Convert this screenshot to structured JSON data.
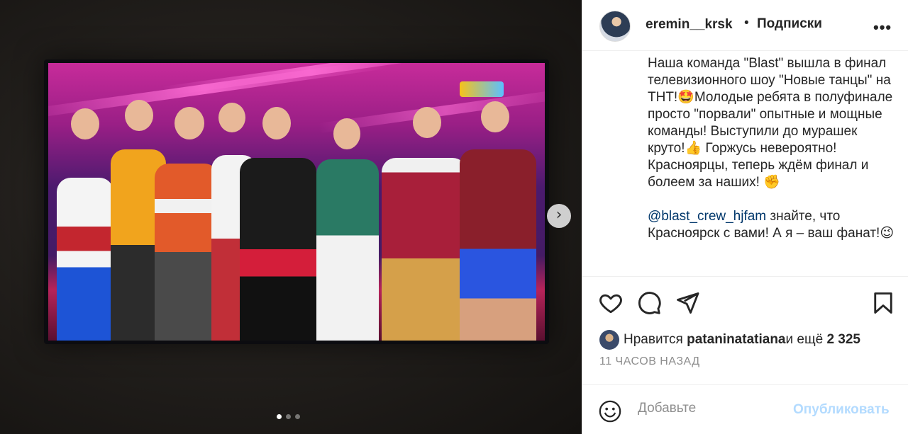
{
  "post": {
    "username": "eremin__krsk",
    "separator": "•",
    "follow_label": "Подписки",
    "more_label": "•••"
  },
  "caption": {
    "text": "Наша команда \"Blast\" вышла в финал телевизионного шоу \"Новые танцы\" на ТНТ!🤩Молодые ребята в полуфинале просто \"порвали\" опытные и мощные команды! Выступили до мурашек круто!👍 Горжусь невероятно! Красноярцы, теперь ждём финал и болеем за наших! ✊",
    "mention": "@blast_crew_hjfam",
    "mention_rest": " знайте, что Красноярск с вами! А я – ваш фанат!😉"
  },
  "likes": {
    "prefix": "Нравится ",
    "user": "pataninatatiana",
    "middle": " и ещё ",
    "count": "2 325"
  },
  "time_ago": "11 ЧАСОВ НАЗАД",
  "comment": {
    "placeholder": "Добавьте",
    "publish_label": "Опубликовать"
  },
  "carousel": {
    "next_glyph": "›",
    "total_dots": 3,
    "active_dot": 1
  },
  "icons": {
    "like": "heart-icon",
    "comment": "comment-icon",
    "share": "send-icon",
    "save": "bookmark-icon",
    "emoji": "smiley-icon",
    "next": "chevron-right-icon"
  }
}
